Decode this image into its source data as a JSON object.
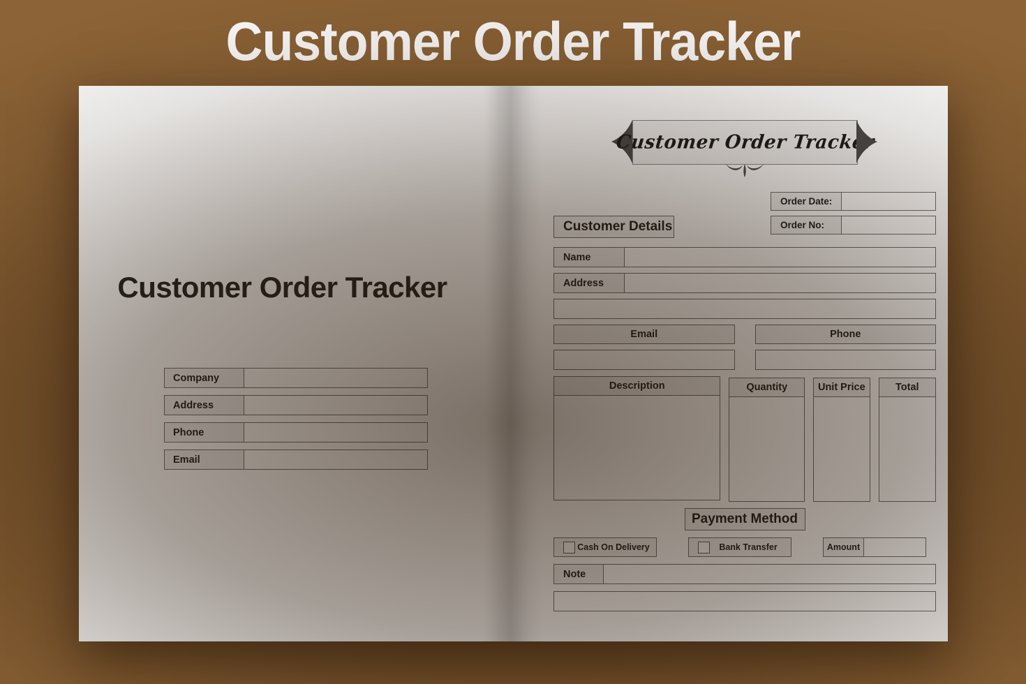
{
  "header": {
    "title": "Customer Order Tracker"
  },
  "colors": {
    "background_brown": "#8C6336",
    "page_white": "#FFFFFF",
    "label_fill": "#F0F0F0",
    "border_gray": "#6E6E6E",
    "text_dark": "#1D1D1D",
    "banner_fill": "#F2F2F2",
    "banner_wing": "#4A4A4A"
  },
  "left_page": {
    "title": "Customer Order Tracker",
    "fields": [
      {
        "label": "Company",
        "value": "",
        "placeholder": ""
      },
      {
        "label": "Address",
        "value": "",
        "placeholder": ""
      },
      {
        "label": "Phone",
        "value": "",
        "placeholder": ""
      },
      {
        "label": "Email",
        "value": "",
        "placeholder": ""
      }
    ]
  },
  "right_page": {
    "banner": {
      "text": "Customer Order Tracker"
    },
    "order_info": [
      {
        "label": "Order Date:",
        "value": ""
      },
      {
        "label": "Order No:",
        "value": ""
      }
    ],
    "customer_details_heading": "Customer Details",
    "customer_fields": [
      {
        "label": "Name",
        "value": ""
      },
      {
        "label": "Address",
        "value": ""
      }
    ],
    "address_overflow_value": "",
    "contact": [
      {
        "label": "Email",
        "value": ""
      },
      {
        "label": "Phone",
        "value": ""
      }
    ],
    "items_table": {
      "columns": [
        "Description",
        "Quantity",
        "Unit Price",
        "Total"
      ],
      "rows": []
    },
    "payment_method_heading": "Payment Method",
    "payment_options": [
      {
        "label": "Cash On Delivery",
        "checked": false
      },
      {
        "label": "Bank Transfer",
        "checked": false
      }
    ],
    "amount": {
      "label": "Amount",
      "value": ""
    },
    "note": {
      "label": "Note",
      "value": ""
    },
    "note_overflow_value": ""
  }
}
